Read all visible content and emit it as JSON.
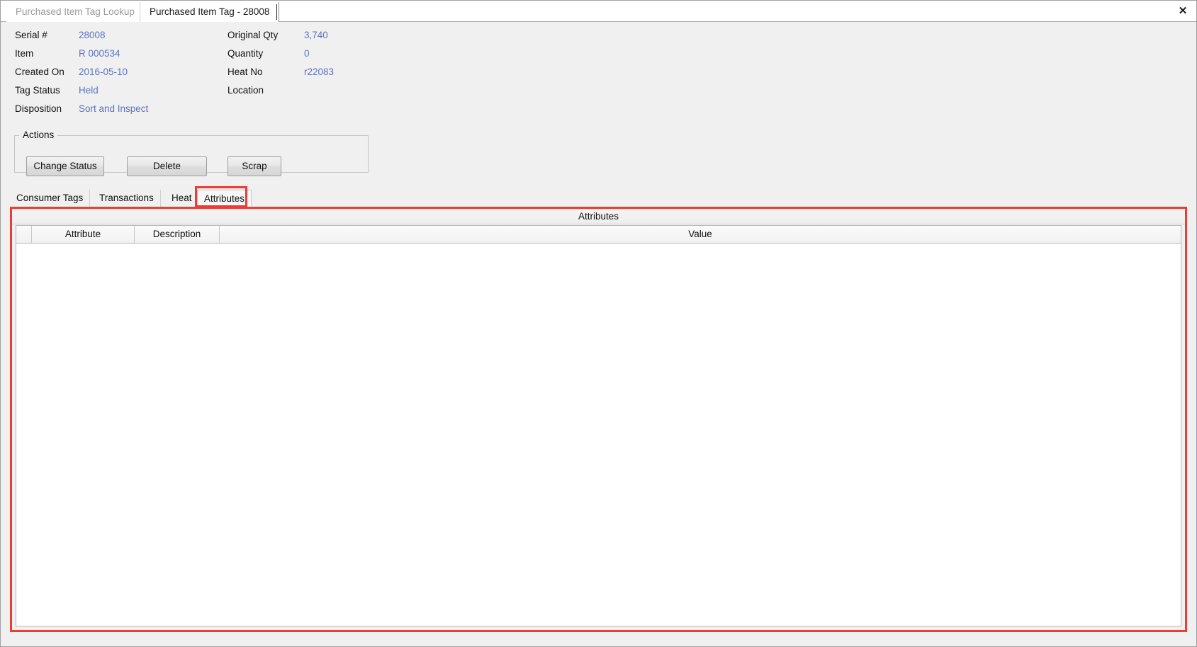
{
  "window": {
    "close_label": "✕"
  },
  "doc_tabs": [
    {
      "label": "Purchased Item Tag Lookup",
      "active": false
    },
    {
      "label": "Purchased Item Tag - 28008",
      "active": true
    }
  ],
  "details": {
    "left_column": [
      {
        "label": "Serial #",
        "value": "28008"
      },
      {
        "label": "Item",
        "value": "R 000534"
      },
      {
        "label": "Created On",
        "value": "2016-05-10"
      },
      {
        "label": "Tag Status",
        "value": "Held"
      },
      {
        "label": "Disposition",
        "value": "Sort and Inspect"
      }
    ],
    "right_column": [
      {
        "label": "Original Qty",
        "value": "3,740"
      },
      {
        "label": "Quantity",
        "value": "0"
      },
      {
        "label": "Heat No",
        "value": "r22083"
      },
      {
        "label": "Location",
        "value": ""
      }
    ]
  },
  "actions": {
    "title": "Actions",
    "buttons": [
      {
        "label": "Change Status"
      },
      {
        "label": "Delete"
      },
      {
        "label": "Scrap"
      }
    ]
  },
  "tabs": [
    {
      "label": "Consumer Tags",
      "selected": false
    },
    {
      "label": "Transactions",
      "selected": false
    },
    {
      "label": "Heat",
      "selected": false
    },
    {
      "label": "Attributes",
      "selected": true
    }
  ],
  "attributes_panel": {
    "header": "Attributes",
    "columns": [
      {
        "label": "Attribute"
      },
      {
        "label": "Description"
      },
      {
        "label": "Value"
      }
    ],
    "rows": []
  },
  "colors": {
    "value_text": "#5b73c4",
    "annotation": "#ee3b33",
    "window_bg": "#f0f0f0",
    "grid_bg": "#ffffff"
  }
}
